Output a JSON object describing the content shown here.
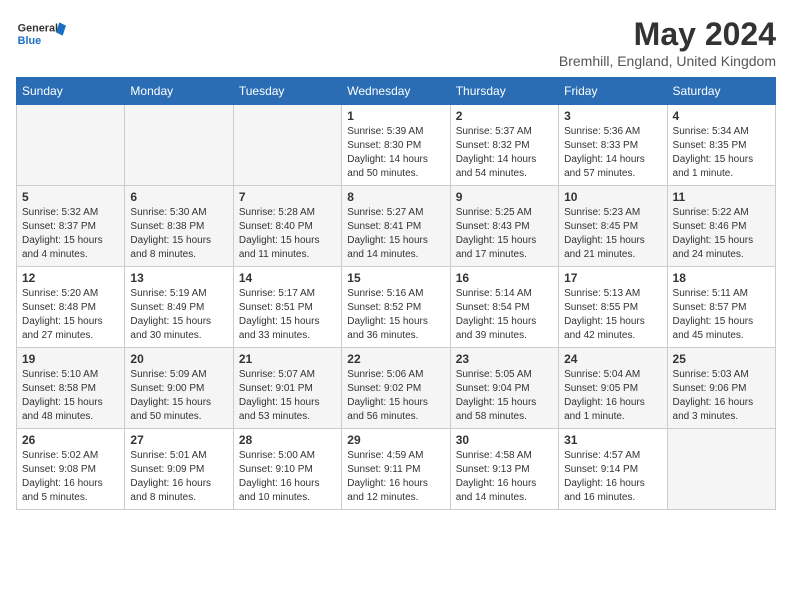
{
  "header": {
    "logo_general": "General",
    "logo_blue": "Blue",
    "month_year": "May 2024",
    "location": "Bremhill, England, United Kingdom"
  },
  "weekdays": [
    "Sunday",
    "Monday",
    "Tuesday",
    "Wednesday",
    "Thursday",
    "Friday",
    "Saturday"
  ],
  "weeks": [
    [
      {
        "day": "",
        "info": ""
      },
      {
        "day": "",
        "info": ""
      },
      {
        "day": "",
        "info": ""
      },
      {
        "day": "1",
        "info": "Sunrise: 5:39 AM\nSunset: 8:30 PM\nDaylight: 14 hours\nand 50 minutes."
      },
      {
        "day": "2",
        "info": "Sunrise: 5:37 AM\nSunset: 8:32 PM\nDaylight: 14 hours\nand 54 minutes."
      },
      {
        "day": "3",
        "info": "Sunrise: 5:36 AM\nSunset: 8:33 PM\nDaylight: 14 hours\nand 57 minutes."
      },
      {
        "day": "4",
        "info": "Sunrise: 5:34 AM\nSunset: 8:35 PM\nDaylight: 15 hours\nand 1 minute."
      }
    ],
    [
      {
        "day": "5",
        "info": "Sunrise: 5:32 AM\nSunset: 8:37 PM\nDaylight: 15 hours\nand 4 minutes."
      },
      {
        "day": "6",
        "info": "Sunrise: 5:30 AM\nSunset: 8:38 PM\nDaylight: 15 hours\nand 8 minutes."
      },
      {
        "day": "7",
        "info": "Sunrise: 5:28 AM\nSunset: 8:40 PM\nDaylight: 15 hours\nand 11 minutes."
      },
      {
        "day": "8",
        "info": "Sunrise: 5:27 AM\nSunset: 8:41 PM\nDaylight: 15 hours\nand 14 minutes."
      },
      {
        "day": "9",
        "info": "Sunrise: 5:25 AM\nSunset: 8:43 PM\nDaylight: 15 hours\nand 17 minutes."
      },
      {
        "day": "10",
        "info": "Sunrise: 5:23 AM\nSunset: 8:45 PM\nDaylight: 15 hours\nand 21 minutes."
      },
      {
        "day": "11",
        "info": "Sunrise: 5:22 AM\nSunset: 8:46 PM\nDaylight: 15 hours\nand 24 minutes."
      }
    ],
    [
      {
        "day": "12",
        "info": "Sunrise: 5:20 AM\nSunset: 8:48 PM\nDaylight: 15 hours\nand 27 minutes."
      },
      {
        "day": "13",
        "info": "Sunrise: 5:19 AM\nSunset: 8:49 PM\nDaylight: 15 hours\nand 30 minutes."
      },
      {
        "day": "14",
        "info": "Sunrise: 5:17 AM\nSunset: 8:51 PM\nDaylight: 15 hours\nand 33 minutes."
      },
      {
        "day": "15",
        "info": "Sunrise: 5:16 AM\nSunset: 8:52 PM\nDaylight: 15 hours\nand 36 minutes."
      },
      {
        "day": "16",
        "info": "Sunrise: 5:14 AM\nSunset: 8:54 PM\nDaylight: 15 hours\nand 39 minutes."
      },
      {
        "day": "17",
        "info": "Sunrise: 5:13 AM\nSunset: 8:55 PM\nDaylight: 15 hours\nand 42 minutes."
      },
      {
        "day": "18",
        "info": "Sunrise: 5:11 AM\nSunset: 8:57 PM\nDaylight: 15 hours\nand 45 minutes."
      }
    ],
    [
      {
        "day": "19",
        "info": "Sunrise: 5:10 AM\nSunset: 8:58 PM\nDaylight: 15 hours\nand 48 minutes."
      },
      {
        "day": "20",
        "info": "Sunrise: 5:09 AM\nSunset: 9:00 PM\nDaylight: 15 hours\nand 50 minutes."
      },
      {
        "day": "21",
        "info": "Sunrise: 5:07 AM\nSunset: 9:01 PM\nDaylight: 15 hours\nand 53 minutes."
      },
      {
        "day": "22",
        "info": "Sunrise: 5:06 AM\nSunset: 9:02 PM\nDaylight: 15 hours\nand 56 minutes."
      },
      {
        "day": "23",
        "info": "Sunrise: 5:05 AM\nSunset: 9:04 PM\nDaylight: 15 hours\nand 58 minutes."
      },
      {
        "day": "24",
        "info": "Sunrise: 5:04 AM\nSunset: 9:05 PM\nDaylight: 16 hours\nand 1 minute."
      },
      {
        "day": "25",
        "info": "Sunrise: 5:03 AM\nSunset: 9:06 PM\nDaylight: 16 hours\nand 3 minutes."
      }
    ],
    [
      {
        "day": "26",
        "info": "Sunrise: 5:02 AM\nSunset: 9:08 PM\nDaylight: 16 hours\nand 5 minutes."
      },
      {
        "day": "27",
        "info": "Sunrise: 5:01 AM\nSunset: 9:09 PM\nDaylight: 16 hours\nand 8 minutes."
      },
      {
        "day": "28",
        "info": "Sunrise: 5:00 AM\nSunset: 9:10 PM\nDaylight: 16 hours\nand 10 minutes."
      },
      {
        "day": "29",
        "info": "Sunrise: 4:59 AM\nSunset: 9:11 PM\nDaylight: 16 hours\nand 12 minutes."
      },
      {
        "day": "30",
        "info": "Sunrise: 4:58 AM\nSunset: 9:13 PM\nDaylight: 16 hours\nand 14 minutes."
      },
      {
        "day": "31",
        "info": "Sunrise: 4:57 AM\nSunset: 9:14 PM\nDaylight: 16 hours\nand 16 minutes."
      },
      {
        "day": "",
        "info": ""
      }
    ]
  ]
}
